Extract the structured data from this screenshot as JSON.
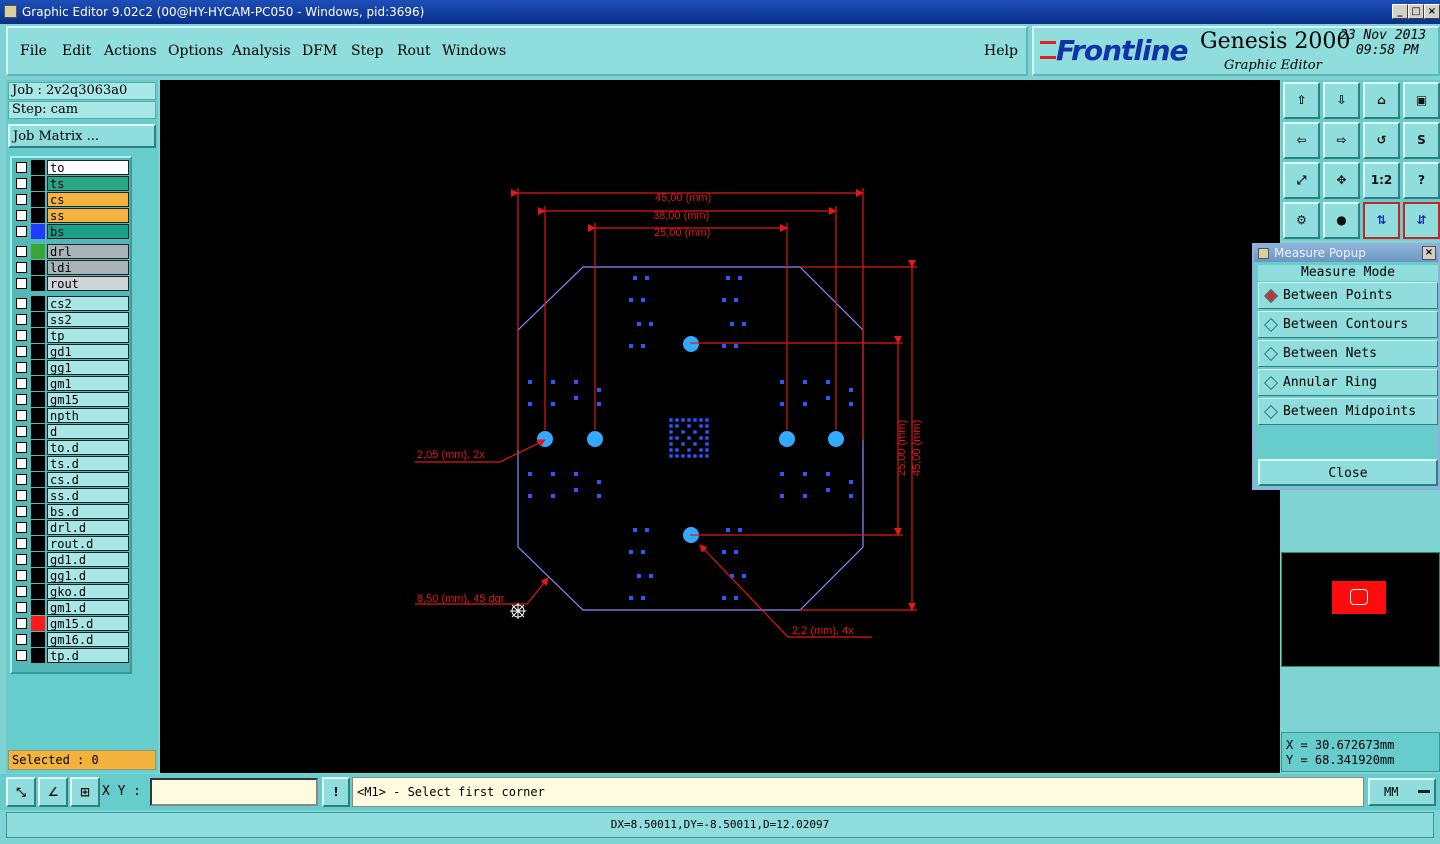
{
  "window": {
    "title": "Graphic Editor 9.02c2 (00@HY-HYCAM-PC050 - Windows, pid:3696)"
  },
  "menu": {
    "items": [
      "File",
      "Edit",
      "Actions",
      "Options",
      "Analysis",
      "DFM",
      "Step",
      "Rout",
      "Windows"
    ],
    "help": "Help"
  },
  "brand": {
    "logo": "Frontline",
    "product": "Genesis 2000",
    "subtitle": "Graphic Editor",
    "date": "23 Nov 2013",
    "time": "09:58 PM"
  },
  "job": {
    "job_label": "Job : 2v2q3063a0",
    "step_label": "Step: cam",
    "matrix_button": "Job Matrix ..."
  },
  "layers": [
    {
      "name": "to",
      "color": "#ffffff",
      "sw": "#000000"
    },
    {
      "name": "ts",
      "color": "#2aa586",
      "sw": "#000000"
    },
    {
      "name": "cs",
      "color": "#f4b23e",
      "sw": "#000000"
    },
    {
      "name": "ss",
      "color": "#f4b23e",
      "sw": "#000000"
    },
    {
      "name": "bs",
      "color": "#1d9f8a",
      "sw": "#1e3cff"
    },
    {
      "name": "drl",
      "color": "#a9b3b8",
      "sw": "#3aa533"
    },
    {
      "name": "ldi",
      "color": "#a9b3b8",
      "sw": "#000000"
    },
    {
      "name": "rout",
      "color": "#cfd4d6",
      "sw": "#000000"
    },
    {
      "name": "cs2",
      "color": "#a9e6e6",
      "sw": "#000000"
    },
    {
      "name": "ss2",
      "color": "#a9e6e6",
      "sw": "#000000"
    },
    {
      "name": "tp",
      "color": "#a9e6e6",
      "sw": "#000000"
    },
    {
      "name": "gd1",
      "color": "#a9e6e6",
      "sw": "#000000"
    },
    {
      "name": "gg1",
      "color": "#a9e6e6",
      "sw": "#000000"
    },
    {
      "name": "gm1",
      "color": "#a9e6e6",
      "sw": "#000000"
    },
    {
      "name": "gm15",
      "color": "#a9e6e6",
      "sw": "#000000"
    },
    {
      "name": "npth",
      "color": "#a9e6e6",
      "sw": "#000000"
    },
    {
      "name": "d",
      "color": "#a9e6e6",
      "sw": "#000000"
    },
    {
      "name": "to.d",
      "color": "#a9e6e6",
      "sw": "#000000"
    },
    {
      "name": "ts.d",
      "color": "#a9e6e6",
      "sw": "#000000"
    },
    {
      "name": "cs.d",
      "color": "#a9e6e6",
      "sw": "#000000"
    },
    {
      "name": "ss.d",
      "color": "#a9e6e6",
      "sw": "#000000"
    },
    {
      "name": "bs.d",
      "color": "#a9e6e6",
      "sw": "#000000"
    },
    {
      "name": "drl.d",
      "color": "#a9e6e6",
      "sw": "#000000"
    },
    {
      "name": "rout.d",
      "color": "#a9e6e6",
      "sw": "#000000"
    },
    {
      "name": "gd1.d",
      "color": "#a9e6e6",
      "sw": "#000000"
    },
    {
      "name": "gg1.d",
      "color": "#a9e6e6",
      "sw": "#000000"
    },
    {
      "name": "gko.d",
      "color": "#a9e6e6",
      "sw": "#000000"
    },
    {
      "name": "gm1.d",
      "color": "#a9e6e6",
      "sw": "#000000"
    },
    {
      "name": "gm15.d",
      "color": "#a9e6e6",
      "sw": "#ff1a1a"
    },
    {
      "name": "gm16.d",
      "color": "#a9e6e6",
      "sw": "#000000"
    },
    {
      "name": "tp.d",
      "color": "#a9e6e6",
      "sw": "#000000"
    }
  ],
  "selected": "Selected : 0",
  "dimensions": {
    "d45": "45,00 (mm)",
    "d38": "38,00 (mm)",
    "d25": "25,00 (mm)",
    "dia": "2,05 (mm), 2x",
    "chamfer": "8,50 (mm), 45 dgr",
    "hole": "2,2 (mm), 4x",
    "v25": "25,00 (mm)",
    "v45": "45,00 (mm)"
  },
  "tools": [
    "1:2",
    "?"
  ],
  "measure": {
    "title": "Measure Popup",
    "mode": "Measure Mode",
    "options": [
      "Between Points",
      "Between Contours",
      "Between Nets",
      "Annular Ring",
      "Between Midpoints"
    ],
    "close": "Close"
  },
  "coords": {
    "x": "X  =  30.672673mm",
    "y": "Y  =  68.341920mm"
  },
  "bottom": {
    "xy_label": "X Y :",
    "xy_value": "",
    "prompt": "<M1> - Select first corner",
    "units": "MM"
  },
  "status": "DX=8.50011,DY=-8.50011,D=12.02097"
}
